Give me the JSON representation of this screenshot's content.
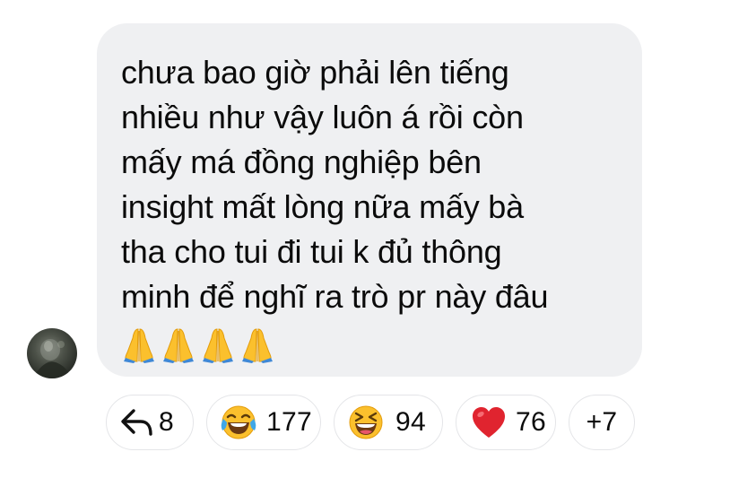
{
  "comment": {
    "lines": [
      "chưa bao giờ phải lên tiếng",
      "nhiều như vậy luôn á rồi còn",
      "mấy má đồng nghiệp bên",
      "insight mất lòng nữa mấy bà",
      "tha cho tui đi tui k đủ thông",
      "minh để nghĩ ra trò pr này đâu"
    ],
    "emoji": [
      "🙏",
      "🙏",
      "🙏",
      "🙏"
    ]
  },
  "reactions": {
    "reply": {
      "icon": "reply-arrow-icon",
      "count": "8"
    },
    "haha": {
      "icon": "tears-of-joy-emoji-icon",
      "count": "177"
    },
    "laugh": {
      "icon": "grinning-squinting-emoji-icon",
      "count": "94"
    },
    "heart": {
      "icon": "red-heart-icon",
      "count": "76"
    },
    "more": {
      "label": "+7"
    }
  },
  "colors": {
    "bubble": "#eff0f2",
    "text": "#0b0b0b",
    "pill_border": "#e4e5e8",
    "heart": "#e0242f",
    "emoji_yellow": "#fbc02d"
  }
}
